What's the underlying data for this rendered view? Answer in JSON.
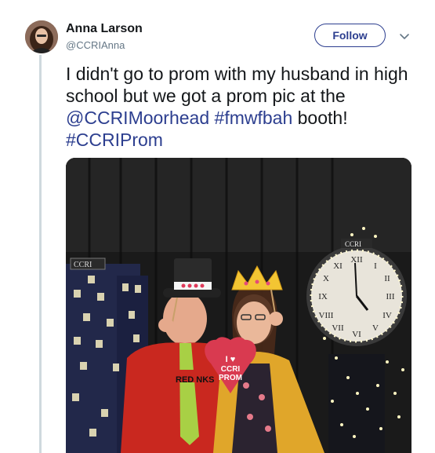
{
  "tweet": {
    "author": {
      "name": "Anna Larson",
      "handle": "@CCRIAnna"
    },
    "follow_label": "Follow",
    "text_parts": [
      "I didn't go to prom with my husband in high school but we got a prom pic at the ",
      "@CCRIMoorhead",
      " ",
      "#fmwfbah",
      " booth! ",
      "#CCRIProm"
    ],
    "photo": {
      "sign_text_1": "CCRI",
      "prop_heart_line1": "I ♥",
      "prop_heart_line2": "CCRI",
      "prop_heart_line3": "PROM",
      "shirt_text": "RED   NKS",
      "clock_logo": "CCRI"
    }
  },
  "colors": {
    "link": "#2c3e8f",
    "text": "#14171a",
    "muted": "#657786"
  },
  "icons": {
    "chevron": "chevron-down-icon"
  }
}
